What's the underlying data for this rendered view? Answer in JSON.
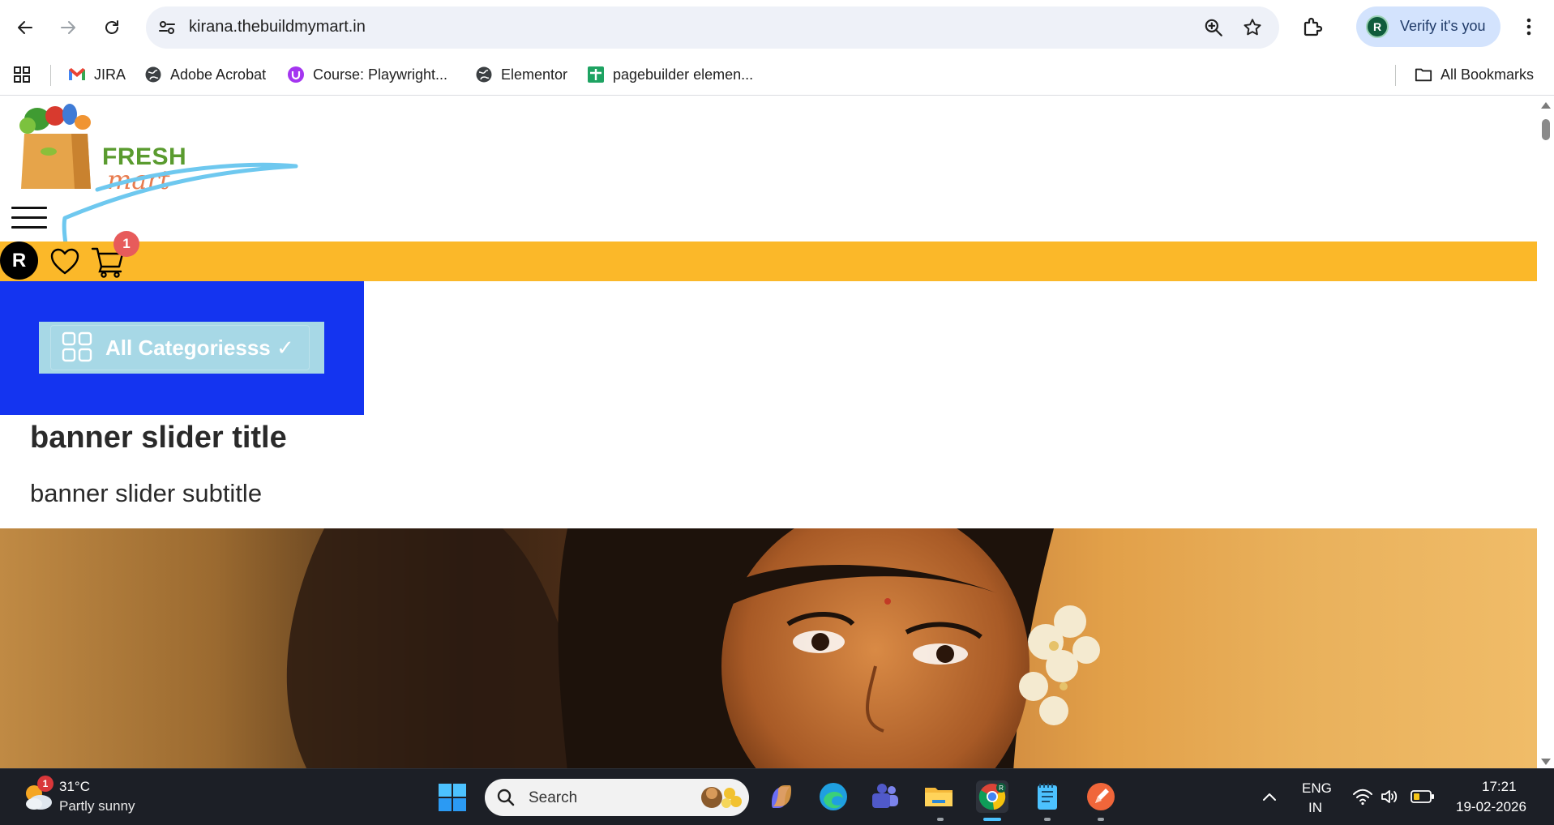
{
  "browser": {
    "url": "kirana.thebuildmymart.in",
    "verify_label": "Verify it's you",
    "profile_initial": "R"
  },
  "bookmarks": [
    {
      "label": "JIRA",
      "icon": "gmail-icon"
    },
    {
      "label": "Adobe Acrobat",
      "icon": "globe-icon"
    },
    {
      "label": "Course: Playwright...",
      "icon": "udemy-icon"
    },
    {
      "label": "Elementor",
      "icon": "globe-icon"
    },
    {
      "label": "pagebuilder elemen...",
      "icon": "sheets-icon"
    }
  ],
  "all_bookmarks_label": "All Bookmarks",
  "site": {
    "logo_fresh": "FRESH",
    "logo_mart": "mart",
    "user_initial": "R",
    "cart_count": "1",
    "categories_button": "All Categoriesss ✓",
    "banner_title": "banner slider title",
    "banner_subtitle": "banner slider subtitle",
    "colors": {
      "yellow_bar": "#fbb829",
      "category_panel": "#1434f0",
      "category_button": "#a7d8e6"
    }
  },
  "taskbar": {
    "weather_temp": "31°C",
    "weather_desc": "Partly sunny",
    "weather_badge": "1",
    "search_label": "Search",
    "lang_line1": "ENG",
    "lang_line2": "IN",
    "time": "17:21",
    "date": "19-02-2026"
  }
}
